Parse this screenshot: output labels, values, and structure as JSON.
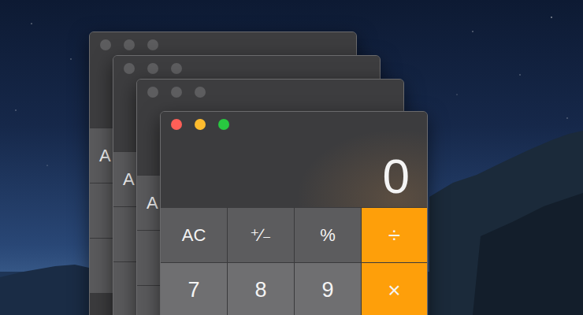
{
  "windows": [
    {
      "focused": false,
      "keys": [
        {
          "label": "A"
        }
      ]
    },
    {
      "focused": false,
      "keys": [
        {
          "label": "A"
        }
      ]
    },
    {
      "focused": false,
      "keys": [
        {
          "label": "A"
        }
      ]
    },
    {
      "focused": true,
      "display": "0",
      "keys": [
        {
          "label": "AC",
          "kind": "function"
        },
        {
          "label": "⁺∕₋",
          "kind": "function"
        },
        {
          "label": "%",
          "kind": "function"
        },
        {
          "label": "÷",
          "kind": "operator"
        },
        {
          "label": "7",
          "kind": "digit"
        },
        {
          "label": "8",
          "kind": "digit"
        },
        {
          "label": "9",
          "kind": "digit"
        },
        {
          "label": "×",
          "kind": "operator"
        }
      ]
    }
  ]
}
